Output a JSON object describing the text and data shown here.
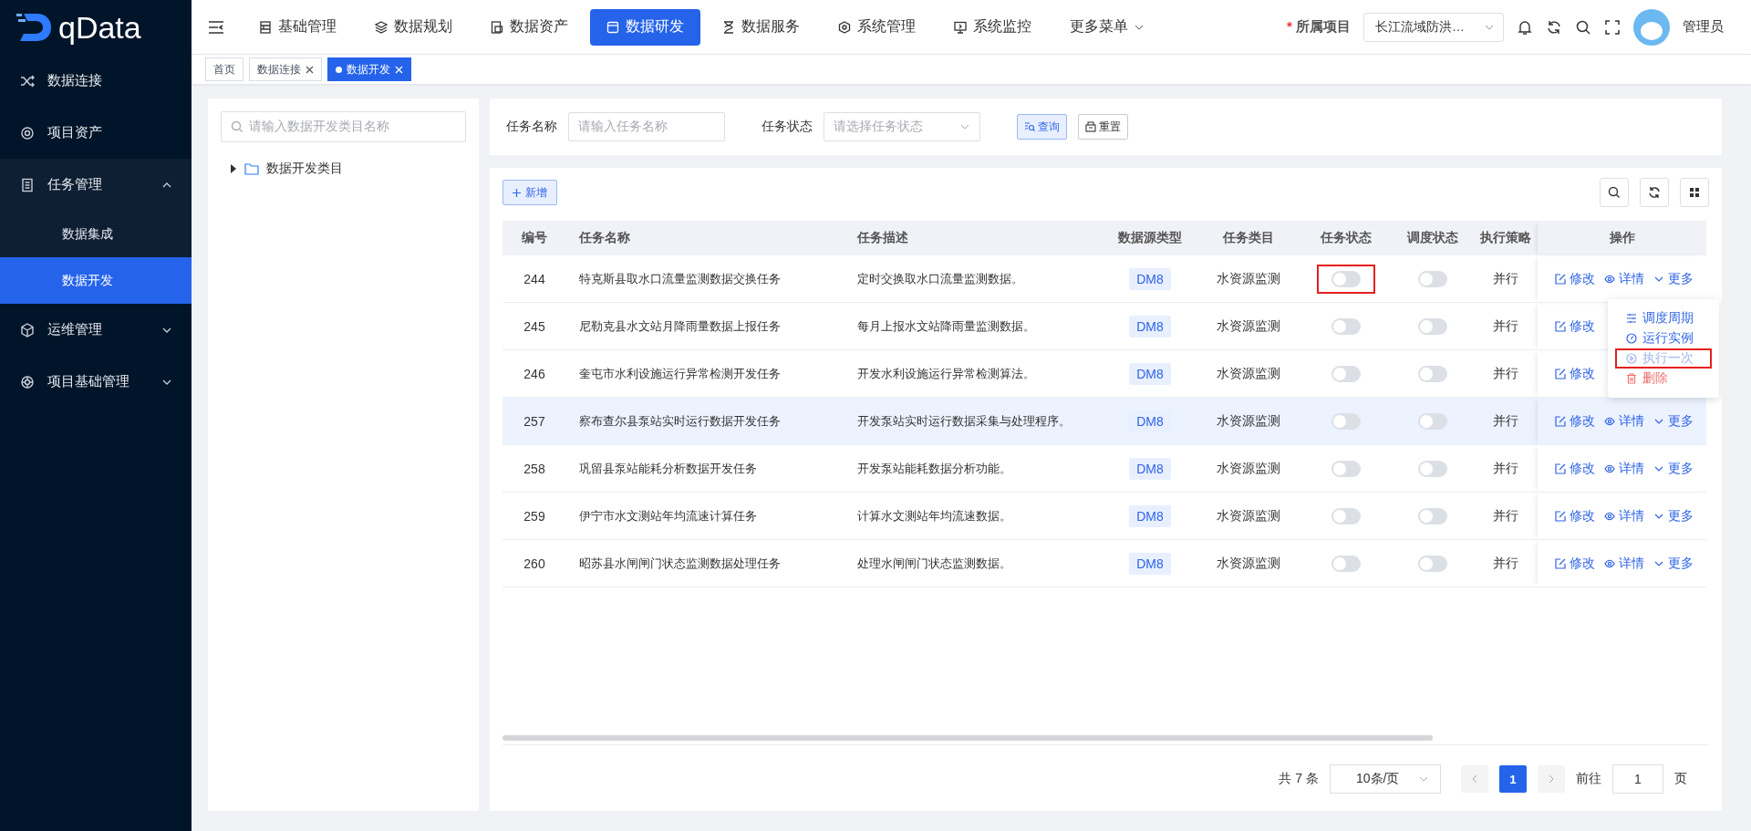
{
  "brand": {
    "name": "qData"
  },
  "top_nav": [
    {
      "label": "基础管理",
      "selected": false
    },
    {
      "label": "数据规划",
      "selected": false
    },
    {
      "label": "数据资产",
      "selected": false
    },
    {
      "label": "数据研发",
      "selected": true
    },
    {
      "label": "数据服务",
      "selected": false
    },
    {
      "label": "系统管理",
      "selected": false
    },
    {
      "label": "系统监控",
      "selected": false
    },
    {
      "label": "更多菜单",
      "selected": false
    }
  ],
  "project": {
    "required_mark": "*",
    "label": "所属项目",
    "value": "长江流域防洪…"
  },
  "user": {
    "name": "管理员"
  },
  "page_tabs": [
    {
      "label": "首页",
      "closable": false,
      "selected": false
    },
    {
      "label": "数据连接",
      "closable": true,
      "selected": false
    },
    {
      "label": "数据开发",
      "closable": true,
      "selected": true
    }
  ],
  "sidebar": [
    {
      "label": "数据连接",
      "expanded": false
    },
    {
      "label": "项目资产",
      "expanded": false
    },
    {
      "label": "任务管理",
      "expanded": true,
      "children": [
        {
          "label": "数据集成",
          "selected": false
        },
        {
          "label": "数据开发",
          "selected": true
        }
      ]
    },
    {
      "label": "运维管理",
      "expanded": false
    },
    {
      "label": "项目基础管理",
      "expanded": false
    }
  ],
  "tree": {
    "search_placeholder": "请输入数据开发类目名称",
    "nodes": [
      {
        "label": "数据开发类目",
        "expanded": false
      }
    ]
  },
  "filters": [
    {
      "label": "任务名称",
      "kind": "input",
      "placeholder": "请输入任务名称"
    },
    {
      "label": "任务状态",
      "kind": "select",
      "placeholder": "请选择任务状态"
    }
  ],
  "filter_buttons": [
    "查询",
    "重置"
  ],
  "add_button": "新增",
  "table": {
    "columns": [
      "编号",
      "任务名称",
      "任务描述",
      "数据源类型",
      "任务类目",
      "任务状态",
      "调度状态",
      "执行策略",
      "操作"
    ],
    "rows": [
      {
        "id": "244",
        "name": "特克斯县取水口流量监测数据交换任务",
        "desc": "定时交换取水口流量监测数据。",
        "source": "DM8",
        "category": "水资源监测",
        "task_on": false,
        "schedule_on": false,
        "task_marked": true,
        "strategy": "并行",
        "actions": [
          "修改",
          "详情",
          "更多"
        ],
        "highlighted": false
      },
      {
        "id": "245",
        "name": "尼勒克县水文站月降雨量数据上报任务",
        "desc": "每月上报水文站降雨量监测数据。",
        "source": "DM8",
        "category": "水资源监测",
        "task_on": false,
        "schedule_on": false,
        "task_marked": false,
        "strategy": "并行",
        "actions": [
          "修改"
        ],
        "highlighted": false
      },
      {
        "id": "246",
        "name": "奎屯市水利设施运行异常检测开发任务",
        "desc": "开发水利设施运行异常检测算法。",
        "source": "DM8",
        "category": "水资源监测",
        "task_on": false,
        "schedule_on": false,
        "task_marked": false,
        "strategy": "并行",
        "actions": [
          "修改"
        ],
        "highlighted": false
      },
      {
        "id": "257",
        "name": "察布查尔县泵站实时运行数据开发任务",
        "desc": "开发泵站实时运行数据采集与处理程序。",
        "source": "DM8",
        "category": "水资源监测",
        "task_on": false,
        "schedule_on": false,
        "task_marked": false,
        "strategy": "并行",
        "actions": [
          "修改",
          "详情",
          "更多"
        ],
        "highlighted": true
      },
      {
        "id": "258",
        "name": "巩留县泵站能耗分析数据开发任务",
        "desc": "开发泵站能耗数据分析功能。",
        "source": "DM8",
        "category": "水资源监测",
        "task_on": false,
        "schedule_on": false,
        "task_marked": false,
        "strategy": "并行",
        "actions": [
          "修改",
          "详情",
          "更多"
        ],
        "highlighted": false
      },
      {
        "id": "259",
        "name": "伊宁市水文测站年均流速计算任务",
        "desc": "计算水文测站年均流速数据。",
        "source": "DM8",
        "category": "水资源监测",
        "task_on": false,
        "schedule_on": false,
        "task_marked": false,
        "strategy": "并行",
        "actions": [
          "修改",
          "详情",
          "更多"
        ],
        "highlighted": false
      },
      {
        "id": "260",
        "name": "昭苏县水闸闸门状态监测数据处理任务",
        "desc": "处理水闸闸门状态监测数据。",
        "source": "DM8",
        "category": "水资源监测",
        "task_on": false,
        "schedule_on": false,
        "task_marked": false,
        "strategy": "并行",
        "actions": [
          "修改",
          "详情",
          "更多"
        ],
        "highlighted": false
      }
    ]
  },
  "more_menu": [
    {
      "label": "调度周期",
      "kind": "normal",
      "marked": false
    },
    {
      "label": "运行实例",
      "kind": "normal",
      "marked": false
    },
    {
      "label": "执行一次",
      "kind": "disabled",
      "marked": true
    },
    {
      "label": "删除",
      "kind": "danger",
      "marked": false
    }
  ],
  "pagination": {
    "total": "共 7 条",
    "page_size": "10条/页",
    "pages": [
      {
        "label": "1",
        "selected": true
      }
    ],
    "goto_label": "前往",
    "goto_value": "1",
    "goto_suffix": "页"
  }
}
